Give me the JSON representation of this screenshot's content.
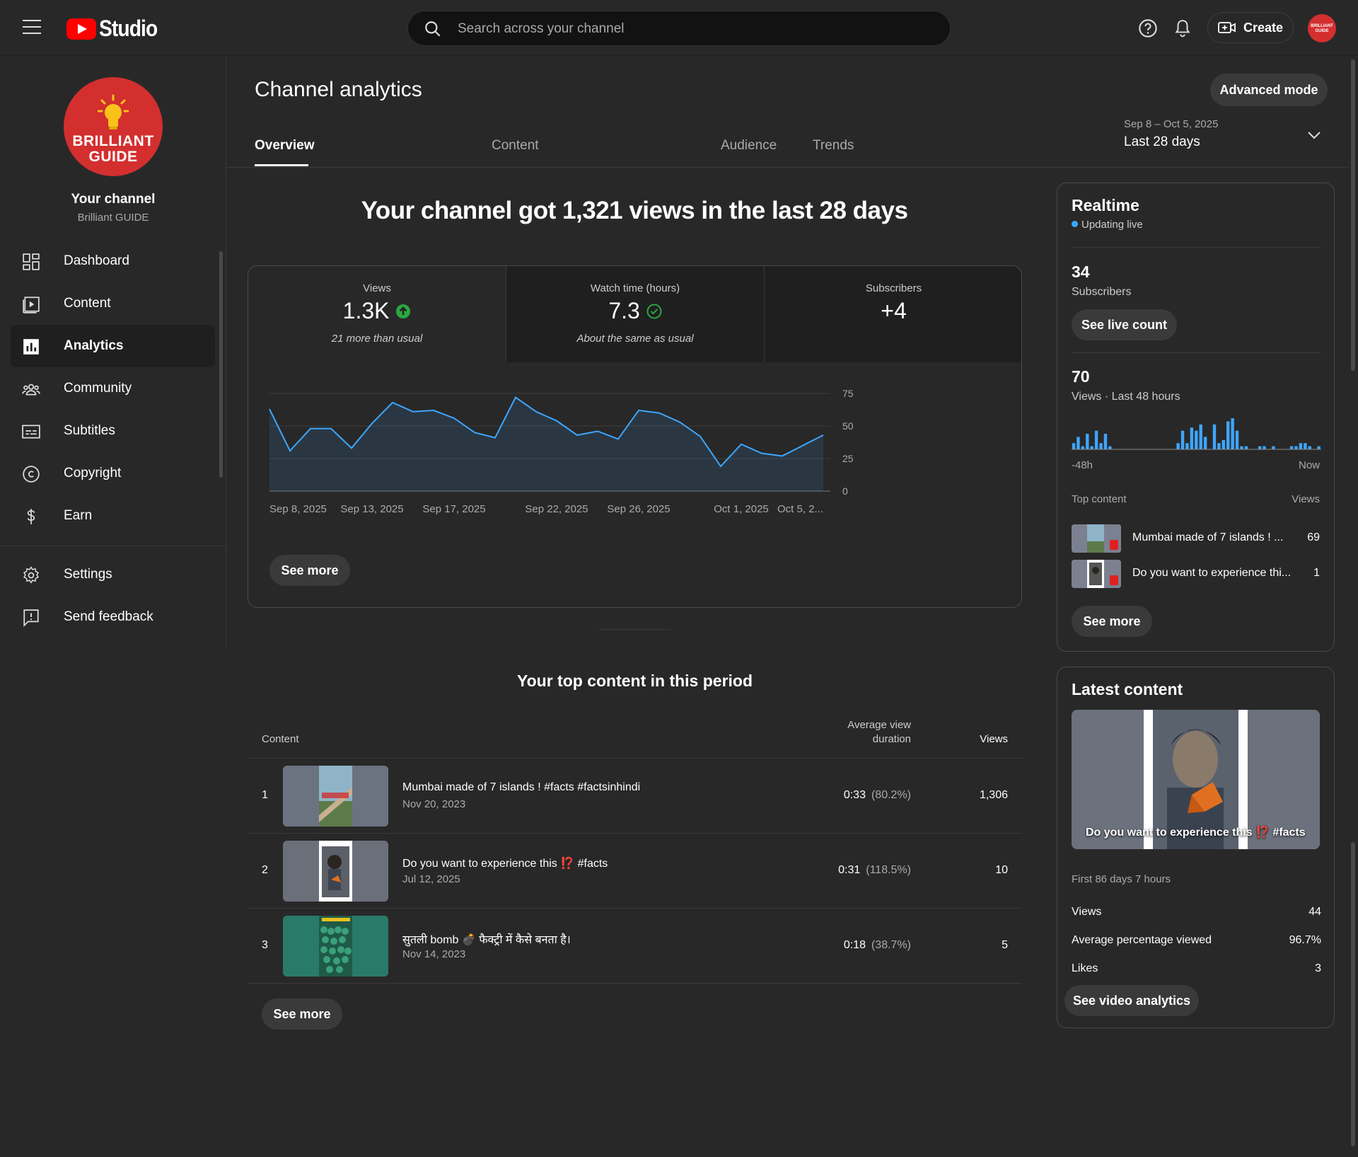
{
  "header": {
    "logo_text": "Studio",
    "search_placeholder": "Search across your channel",
    "create_label": "Create"
  },
  "sidebar": {
    "channel_brand": "BRILLIANT GUIDE",
    "channel_title": "Your channel",
    "channel_name": "Brilliant GUIDE",
    "items": [
      {
        "label": "Dashboard",
        "icon": "dashboard-icon"
      },
      {
        "label": "Content",
        "icon": "content-icon"
      },
      {
        "label": "Analytics",
        "icon": "analytics-icon",
        "active": true
      },
      {
        "label": "Community",
        "icon": "community-icon"
      },
      {
        "label": "Subtitles",
        "icon": "subtitles-icon"
      },
      {
        "label": "Copyright",
        "icon": "copyright-icon"
      },
      {
        "label": "Earn",
        "icon": "earn-icon"
      }
    ],
    "bottom_items": [
      {
        "label": "Settings",
        "icon": "settings-icon"
      },
      {
        "label": "Send feedback",
        "icon": "feedback-icon"
      }
    ]
  },
  "main": {
    "title": "Channel analytics",
    "advanced_mode_label": "Advanced mode",
    "tabs": [
      {
        "label": "Overview",
        "active": true
      },
      {
        "label": "Content"
      },
      {
        "label": "Audience"
      },
      {
        "label": "Trends"
      }
    ],
    "date_range": "Sep 8 – Oct 5, 2025",
    "date_label": "Last 28 days",
    "headline": "Your channel got 1,321 views in the last 28 days",
    "metrics": [
      {
        "label": "Views",
        "value": "1.3K",
        "note": "21 more than usual",
        "status": "up"
      },
      {
        "label": "Watch time (hours)",
        "value": "7.3",
        "note": "About the same as usual",
        "status": "check"
      },
      {
        "label": "Subscribers",
        "value": "+4",
        "note": ""
      }
    ],
    "see_more_label": "See more",
    "top_content": {
      "title": "Your top content in this period",
      "col_content": "Content",
      "col_avd_1": "Average view",
      "col_avd_2": "duration",
      "col_views": "Views",
      "rows": [
        {
          "rank": "1",
          "title": "Mumbai made of 7 islands ! #facts #factsinhindi",
          "date": "Nov 20, 2023",
          "duration": "0:33",
          "pct": "(80.2%)",
          "views": "1,306"
        },
        {
          "rank": "2",
          "title": "Do you want to experience this ⁉️ #facts",
          "date": "Jul 12, 2025",
          "duration": "0:31",
          "pct": "(118.5%)",
          "views": "10"
        },
        {
          "rank": "3",
          "title": "सुतली bomb 💣 फैक्ट्री में कैसे बनता है।",
          "date": "Nov 14, 2023",
          "duration": "0:18",
          "pct": "(38.7%)",
          "views": "5"
        }
      ],
      "see_more_label": "See more"
    }
  },
  "realtime": {
    "title": "Realtime",
    "status": "Updating live",
    "subscribers_value": "34",
    "subscribers_label": "Subscribers",
    "see_live_count_label": "See live count",
    "views_value": "70",
    "views_label": "Views · Last 48 hours",
    "axis_start": "-48h",
    "axis_end": "Now",
    "top_content_label": "Top content",
    "views_col_label": "Views",
    "top_items": [
      {
        "title": "Mumbai made of 7 islands ! ...",
        "views": "69"
      },
      {
        "title": "Do you want to experience thi...",
        "views": "1"
      }
    ],
    "see_more_label": "See more",
    "accent_color": "#3ea6ff"
  },
  "latest": {
    "title": "Latest content",
    "video_caption": "Do you want to experience this ⁉️ #facts",
    "period": "First 86 days 7 hours",
    "stats": [
      {
        "label": "Views",
        "value": "44"
      },
      {
        "label": "Average percentage viewed",
        "value": "96.7%"
      },
      {
        "label": "Likes",
        "value": "3"
      }
    ],
    "button_label": "See video analytics"
  },
  "chart_data": {
    "type": "area",
    "title": "",
    "xlabel": "",
    "ylabel": "",
    "x_tick_labels": [
      "Sep 8, 2025",
      "Sep 13, 2025",
      "Sep 17, 2025",
      "Sep 22, 2025",
      "Sep 26, 2025",
      "Oct 1, 2025",
      "Oct 5, 2..."
    ],
    "y_ticks": [
      0,
      25,
      50,
      75
    ],
    "ylim": [
      0,
      75
    ],
    "grid": true,
    "series": [
      {
        "values": [
          63,
          31,
          48,
          48,
          33,
          52,
          68,
          61,
          62,
          56,
          45,
          41,
          72,
          61,
          54,
          43,
          46,
          40,
          62,
          60,
          53,
          42,
          19,
          36,
          29,
          27,
          35,
          43
        ]
      }
    ],
    "color": "#3ea6ff"
  },
  "realtime_chart": {
    "type": "bar",
    "values": [
      2,
      4,
      1,
      5,
      1,
      6,
      2,
      5,
      1,
      0,
      0,
      0,
      0,
      0,
      0,
      0,
      0,
      0,
      0,
      0,
      0,
      0,
      0,
      2,
      6,
      2,
      7,
      6,
      8,
      4,
      0,
      8,
      2,
      3,
      9,
      10,
      6,
      1,
      1,
      0,
      0,
      1,
      1,
      0,
      1,
      0,
      0,
      0,
      1,
      1,
      2,
      2,
      1,
      0,
      1
    ]
  }
}
